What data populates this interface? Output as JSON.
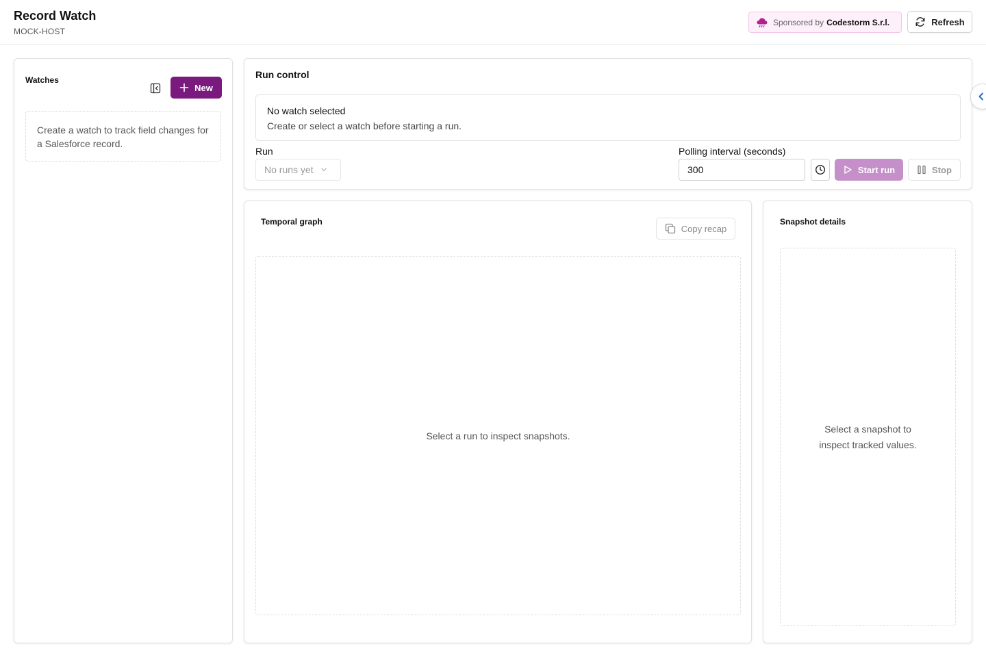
{
  "header": {
    "title": "Record Watch",
    "host": "MOCK-HOST",
    "sponsor_prefix": "Sponsored by",
    "sponsor_name": "Codestorm S.r.l.",
    "refresh_label": "Refresh"
  },
  "watches": {
    "title": "Watches",
    "new_label": "New",
    "empty_text": "Create a watch to track field changes for a Salesforce record."
  },
  "run_control": {
    "title": "Run control",
    "notice_title": "No watch selected",
    "notice_body": "Create or select a watch before starting a run.",
    "run_label": "Run",
    "run_select_value": "No runs yet",
    "polling_label": "Polling interval (seconds)",
    "polling_value": "300",
    "start_label": "Start run",
    "stop_label": "Stop"
  },
  "graph": {
    "title": "Temporal graph",
    "copy_label": "Copy recap",
    "empty_text": "Select a run to inspect snapshots."
  },
  "snapshot": {
    "title": "Snapshot details",
    "empty_text": "Select a snapshot to inspect tracked values."
  },
  "colors": {
    "brand": "#7a1a7e",
    "brand_disabled": "#c58fc9",
    "sponsor_bg": "#fdf0fa",
    "toggle_accent": "#1b6fd1"
  },
  "icons": [
    "cloud-logo-icon",
    "refresh-icon",
    "collapse-panel-icon",
    "plus-icon",
    "chevron-down-icon",
    "clock-icon",
    "play-icon",
    "pause-icon",
    "copy-icon",
    "chevron-left-icon"
  ]
}
